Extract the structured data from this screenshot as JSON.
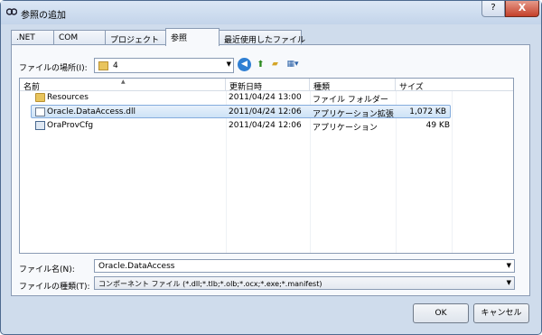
{
  "window": {
    "title": "参照の追加",
    "help_label": "?",
    "close_label": "X"
  },
  "tabs": [
    {
      "label": ".NET"
    },
    {
      "label": "COM"
    },
    {
      "label": "プロジェクト"
    },
    {
      "label": "参照",
      "active": true
    },
    {
      "label": "最近使用したファイル"
    }
  ],
  "lookin": {
    "label": "ファイルの場所(I):",
    "value": "4"
  },
  "list": {
    "columns": [
      "名前",
      "更新日時",
      "種類",
      "サイズ"
    ],
    "rows": [
      {
        "icon": "folder-icon",
        "name": "Resources",
        "date": "2011/04/24 13:00",
        "type": "ファイル フォルダー",
        "size": ""
      },
      {
        "icon": "dll-file-icon",
        "name": "Oracle.DataAccess.dll",
        "date": "2011/04/24 12:06",
        "type": "アプリケーション拡張",
        "size": "1,072 KB",
        "selected": true
      },
      {
        "icon": "exe-file-icon",
        "name": "OraProvCfg",
        "date": "2011/04/24 12:06",
        "type": "アプリケーション",
        "size": "49 KB"
      }
    ]
  },
  "filename": {
    "label": "ファイル名(N):",
    "value": "Oracle.DataAccess"
  },
  "filetype": {
    "label": "ファイルの種類(T):",
    "value": "コンポーネント ファイル (*.dll;*.tlb;*.olb;*.ocx;*.exe;*.manifest)"
  },
  "buttons": {
    "ok": "OK",
    "cancel": "キャンセル"
  },
  "colors": {
    "frame": "#cfdcec",
    "selection": "#cde2f6",
    "close": "#c4402a"
  }
}
